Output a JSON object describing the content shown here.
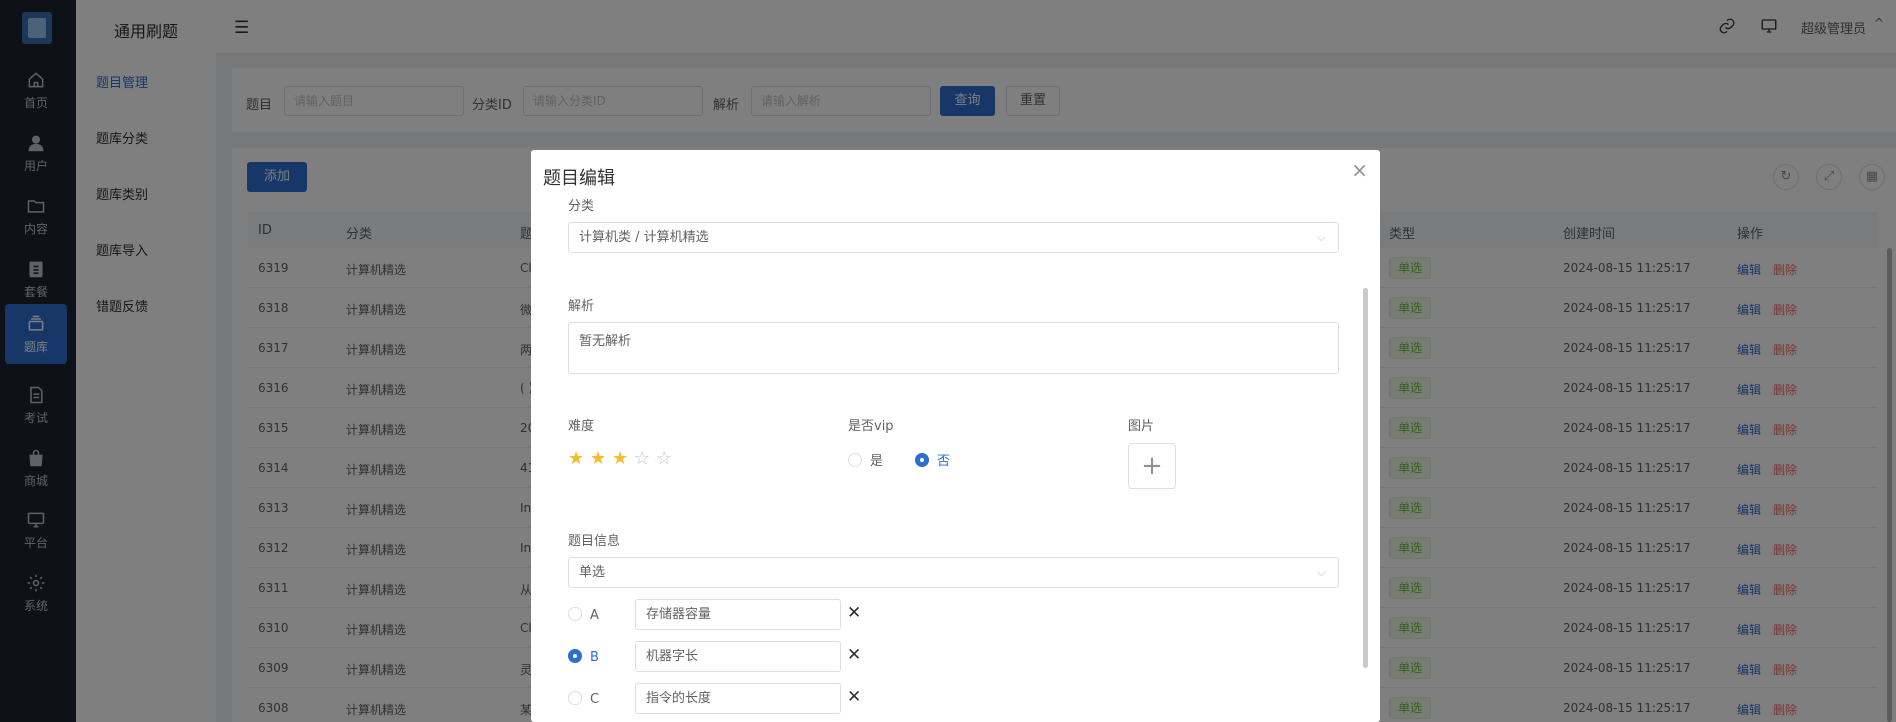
{
  "sidebar": {
    "items": [
      {
        "label": "首页",
        "icon": "home-icon"
      },
      {
        "label": "用户",
        "icon": "user-icon"
      },
      {
        "label": "内容",
        "icon": "folder-icon"
      },
      {
        "label": "套餐",
        "icon": "clipboard-icon"
      },
      {
        "label": "题库",
        "icon": "layers-icon",
        "active": true
      },
      {
        "label": "考试",
        "icon": "document-icon"
      },
      {
        "label": "商城",
        "icon": "shop-icon"
      },
      {
        "label": "平台",
        "icon": "monitor-icon"
      },
      {
        "label": "系统",
        "icon": "gear-icon"
      }
    ]
  },
  "submenu": {
    "title": "通用刷题",
    "items": [
      "题目管理",
      "题库分类",
      "题库类别",
      "题库导入",
      "错题反馈"
    ]
  },
  "header": {
    "user": "超级管理员",
    "caret": "^"
  },
  "search": {
    "title_label": "题目",
    "title_placeholder": "请输入题目",
    "cat_label": "分类ID",
    "cat_placeholder": "请输入分类ID",
    "analysis_label": "解析",
    "analysis_placeholder": "请输入解析",
    "query_btn": "查询",
    "reset_btn": "重置"
  },
  "table": {
    "add_btn": "添加",
    "columns": [
      "ID",
      "分类",
      "题",
      "类型",
      "创建时间",
      "操作"
    ],
    "rows": [
      {
        "id": "6319",
        "cat": "计算机精选",
        "q": "Cl",
        "type": "单选",
        "time": "2024-08-15 11:25:17"
      },
      {
        "id": "6318",
        "cat": "计算机精选",
        "q": "微",
        "type": "单选",
        "time": "2024-08-15 11:25:17"
      },
      {
        "id": "6317",
        "cat": "计算机精选",
        "q": "两",
        "type": "单选",
        "time": "2024-08-15 11:25:17"
      },
      {
        "id": "6316",
        "cat": "计算机精选",
        "q": "( )",
        "type": "单选",
        "time": "2024-08-15 11:25:17"
      },
      {
        "id": "6315",
        "cat": "计算机精选",
        "q": "20",
        "type": "单选",
        "time": "2024-08-15 11:25:17"
      },
      {
        "id": "6314",
        "cat": "计算机精选",
        "q": "41",
        "type": "单选",
        "time": "2024-08-15 11:25:17"
      },
      {
        "id": "6313",
        "cat": "计算机精选",
        "q": "In",
        "type": "单选",
        "time": "2024-08-15 11:25:17"
      },
      {
        "id": "6312",
        "cat": "计算机精选",
        "q": "In",
        "type": "单选",
        "time": "2024-08-15 11:25:17"
      },
      {
        "id": "6311",
        "cat": "计算机精选",
        "q": "从",
        "type": "单选",
        "time": "2024-08-15 11:25:17"
      },
      {
        "id": "6310",
        "cat": "计算机精选",
        "q": "Cl",
        "type": "单选",
        "time": "2024-08-15 11:25:17"
      },
      {
        "id": "6309",
        "cat": "计算机精选",
        "q": "灵",
        "type": "单选",
        "time": "2024-08-15 11:25:17"
      },
      {
        "id": "6308",
        "cat": "计算机精选",
        "q": "某",
        "type": "单选",
        "time": "2024-08-15 11:25:17"
      }
    ],
    "edit": "编辑",
    "del": "删除"
  },
  "modal": {
    "title": "题目编辑",
    "category_label": "分类",
    "category_value": "计算机类 / 计算机精选",
    "analysis_label": "解析",
    "analysis_value": "暂无解析",
    "difficulty_label": "难度",
    "difficulty_rating": 3,
    "difficulty_max": 5,
    "vip_label": "是否vip",
    "vip_yes": "是",
    "vip_no": "否",
    "vip_selected": "否",
    "image_label": "图片",
    "info_label": "题目信息",
    "type_value": "单选",
    "options": [
      {
        "letter": "A",
        "text": "存储器容量",
        "checked": false
      },
      {
        "letter": "B",
        "text": "机器字长",
        "checked": true
      },
      {
        "letter": "C",
        "text": "指令的长度",
        "checked": false
      }
    ]
  },
  "colors": {
    "primary": "#2c6fd1",
    "danger": "#f56c6c",
    "success": "#67c23a",
    "star": "#f7ba2a",
    "sidebar": "#1f2230"
  }
}
